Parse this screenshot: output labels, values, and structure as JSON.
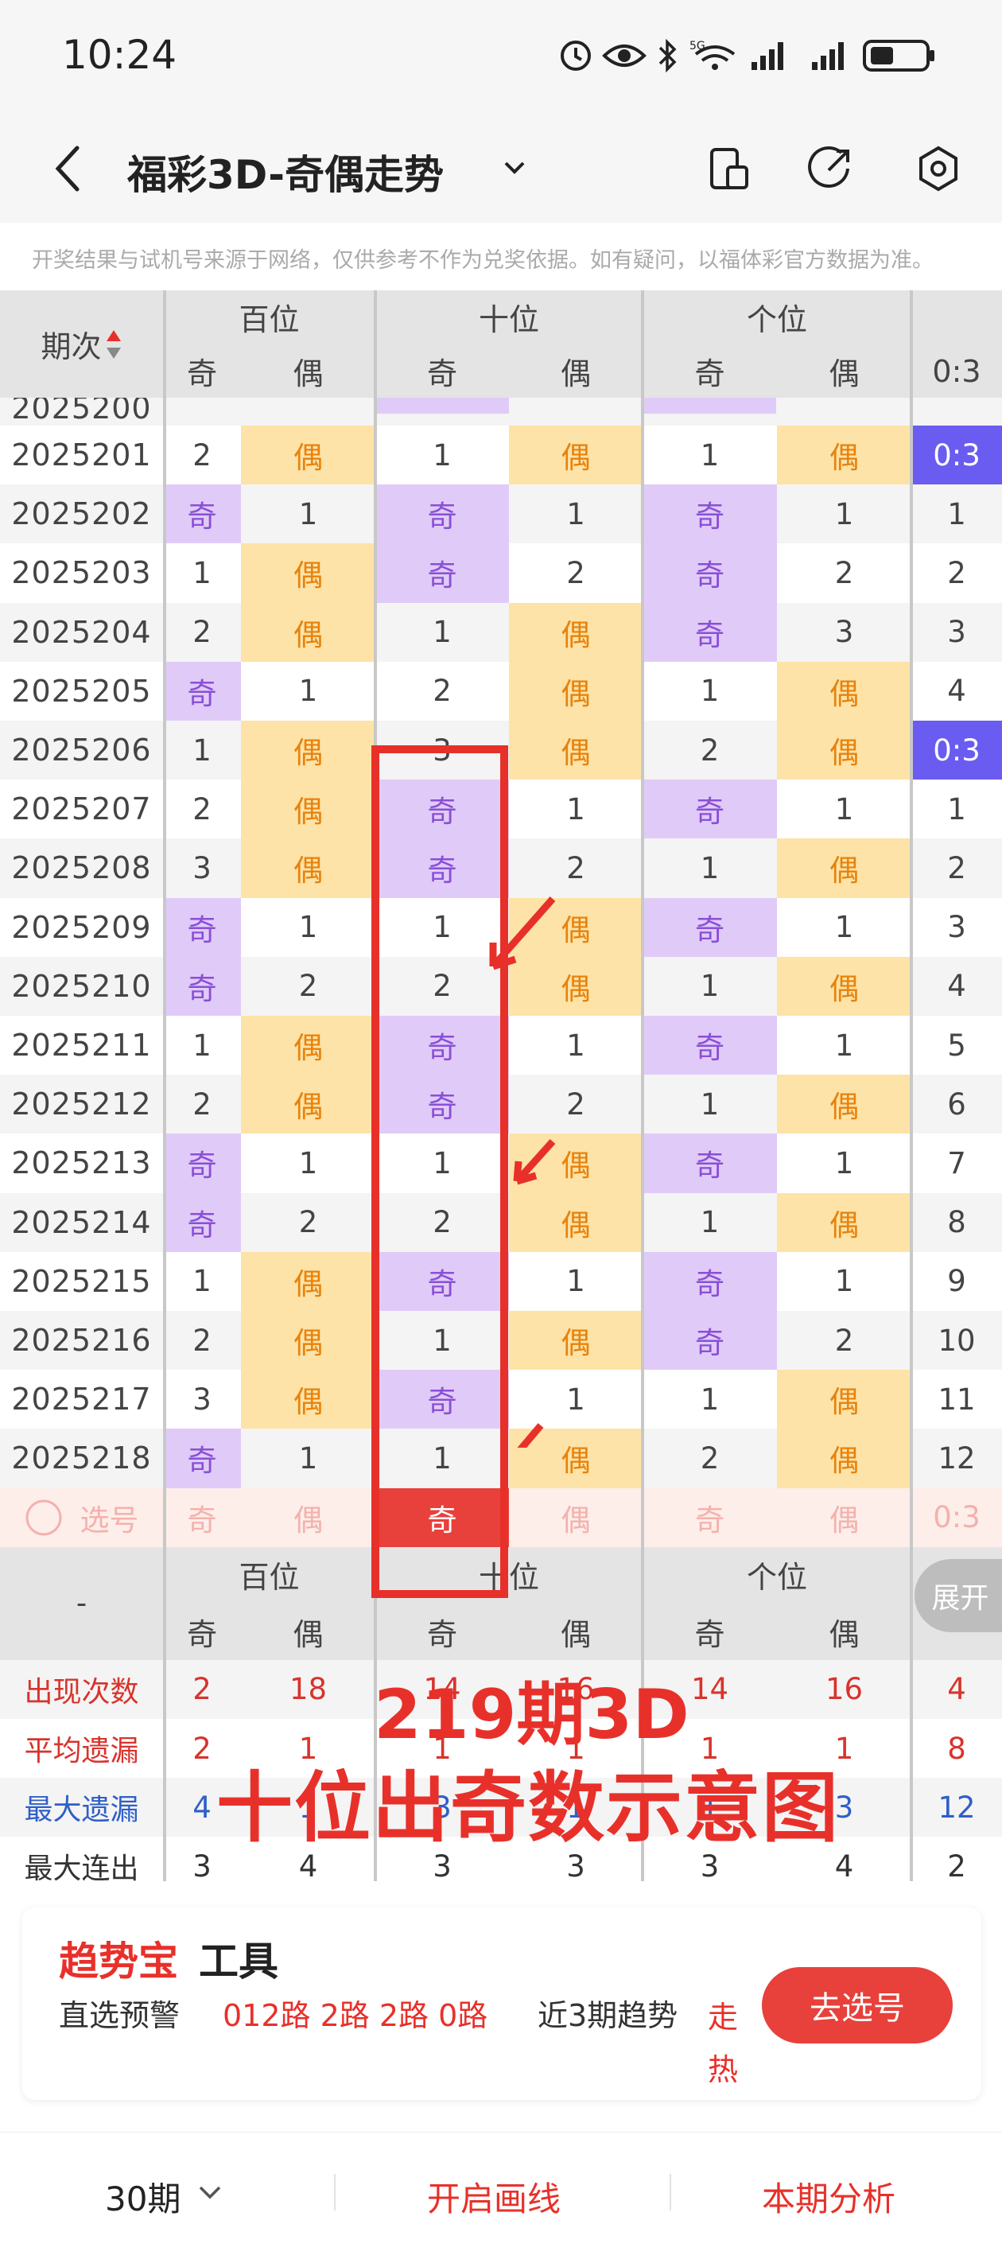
{
  "status_bar": {
    "time": "10:24",
    "network": "5G"
  },
  "header": {
    "title": "福彩3D-奇偶走势"
  },
  "notice": "开奖结果与试机号来源于网络，仅供参考不作为兑奖依据。如有疑问，以福体彩官方数据为准。",
  "table": {
    "period_header": "期次",
    "groups": [
      "百位",
      "十位",
      "个位"
    ],
    "sub_headers": [
      "奇",
      "偶",
      "奇",
      "偶",
      "奇",
      "偶",
      "0:3"
    ],
    "partial_top_row": "2025200",
    "rows": [
      {
        "p": "2025201",
        "c": [
          "2",
          "偶",
          "1",
          "偶",
          "1",
          "偶",
          "0:3"
        ]
      },
      {
        "p": "2025202",
        "c": [
          "奇",
          "1",
          "奇",
          "1",
          "奇",
          "1",
          "1"
        ]
      },
      {
        "p": "2025203",
        "c": [
          "1",
          "偶",
          "奇",
          "2",
          "奇",
          "2",
          "2"
        ]
      },
      {
        "p": "2025204",
        "c": [
          "2",
          "偶",
          "1",
          "偶",
          "奇",
          "3",
          "3"
        ]
      },
      {
        "p": "2025205",
        "c": [
          "奇",
          "1",
          "2",
          "偶",
          "1",
          "偶",
          "4"
        ]
      },
      {
        "p": "2025206",
        "c": [
          "1",
          "偶",
          "3",
          "偶",
          "2",
          "偶",
          "0:3"
        ]
      },
      {
        "p": "2025207",
        "c": [
          "2",
          "偶",
          "奇",
          "1",
          "奇",
          "1",
          "1"
        ]
      },
      {
        "p": "2025208",
        "c": [
          "3",
          "偶",
          "奇",
          "2",
          "1",
          "偶",
          "2"
        ]
      },
      {
        "p": "2025209",
        "c": [
          "奇",
          "1",
          "1",
          "偶",
          "奇",
          "1",
          "3"
        ]
      },
      {
        "p": "2025210",
        "c": [
          "奇",
          "2",
          "2",
          "偶",
          "1",
          "偶",
          "4"
        ]
      },
      {
        "p": "2025211",
        "c": [
          "1",
          "偶",
          "奇",
          "1",
          "奇",
          "1",
          "5"
        ]
      },
      {
        "p": "2025212",
        "c": [
          "2",
          "偶",
          "奇",
          "2",
          "1",
          "偶",
          "6"
        ]
      },
      {
        "p": "2025213",
        "c": [
          "奇",
          "1",
          "1",
          "偶",
          "奇",
          "1",
          "7"
        ]
      },
      {
        "p": "2025214",
        "c": [
          "奇",
          "2",
          "2",
          "偶",
          "1",
          "偶",
          "8"
        ]
      },
      {
        "p": "2025215",
        "c": [
          "1",
          "偶",
          "奇",
          "1",
          "奇",
          "1",
          "9"
        ]
      },
      {
        "p": "2025216",
        "c": [
          "2",
          "偶",
          "1",
          "偶",
          "奇",
          "2",
          "10"
        ]
      },
      {
        "p": "2025217",
        "c": [
          "3",
          "偶",
          "奇",
          "1",
          "1",
          "偶",
          "11"
        ]
      },
      {
        "p": "2025218",
        "c": [
          "奇",
          "1",
          "1",
          "偶",
          "2",
          "偶",
          "12"
        ]
      }
    ],
    "select_row": {
      "label": "选号",
      "c": [
        "奇",
        "偶",
        "奇",
        "偶",
        "奇",
        "偶",
        "0:3"
      ]
    },
    "footer_dash": "-",
    "expand_button": "展开",
    "stats": [
      {
        "label": "出现次数",
        "c": [
          "2",
          "18",
          "14",
          "16",
          "14",
          "16",
          "4"
        ],
        "color": "#d8332c"
      },
      {
        "label": "平均遗漏",
        "c": [
          "2",
          "1",
          "1",
          "1",
          "1",
          "1",
          "8"
        ],
        "color": "#d8332c"
      },
      {
        "label": "最大遗漏",
        "c": [
          "4",
          "1",
          "3",
          "1",
          "1",
          "3",
          "12"
        ],
        "color": "#2f5fc8"
      },
      {
        "label": "最大连出",
        "c": [
          "3",
          "4",
          "3",
          "3",
          "3",
          "4",
          "2"
        ],
        "color": "#333333"
      }
    ]
  },
  "annotation": {
    "line1": "219期3D",
    "line2": "十位出奇数示意图",
    "color": "#e8302a"
  },
  "card": {
    "title_red": "趋势宝",
    "title_black": "工具",
    "label1": "直选预警",
    "routes": "012路 2路 2路 0路",
    "label2": "近3期趋势",
    "trend": "走热",
    "button": "去选号"
  },
  "bottom": {
    "periods": "30期",
    "draw_line": "开启画线",
    "analysis": "本期分析"
  }
}
